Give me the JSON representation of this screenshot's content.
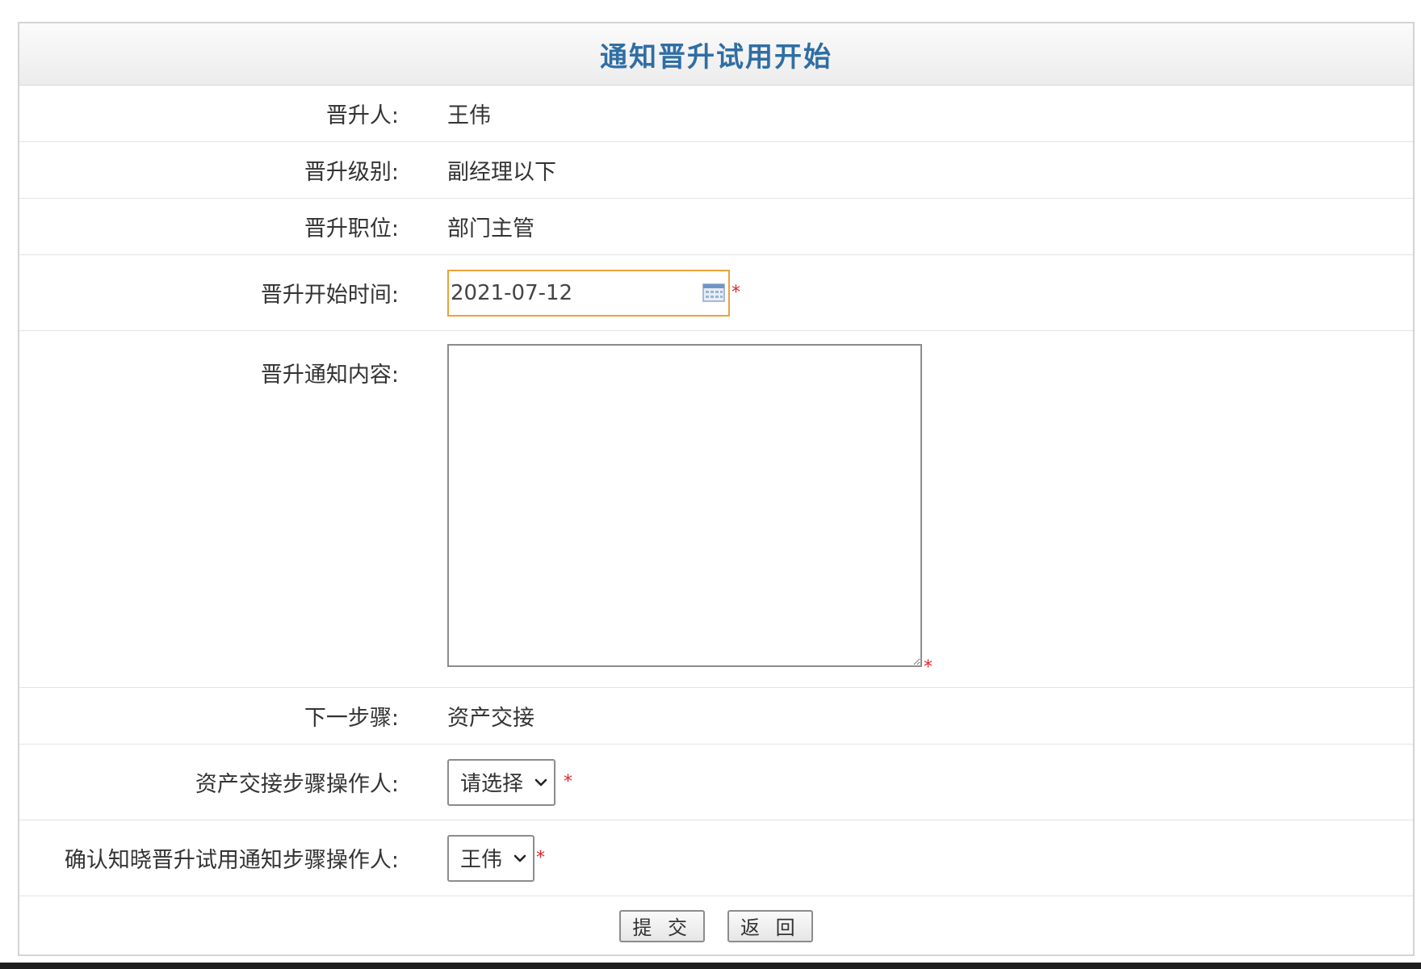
{
  "page": {
    "title": "通知晋升试用开始"
  },
  "form": {
    "promotee": {
      "label": "晋升人:",
      "value": "王伟"
    },
    "level": {
      "label": "晋升级别:",
      "value": "副经理以下"
    },
    "position": {
      "label": "晋升职位:",
      "value": "部门主管"
    },
    "start_date": {
      "label": "晋升开始时间:",
      "value": "2021-07-12",
      "required_mark": "*"
    },
    "notice_content": {
      "label": "晋升通知内容:",
      "value": "",
      "required_mark": "*"
    },
    "next_step": {
      "label": "下一步骤:",
      "value": "资产交接"
    },
    "asset_operator": {
      "label": "资产交接步骤操作人:",
      "selected": "请选择",
      "required_mark": "*"
    },
    "confirm_operator": {
      "label": "确认知晓晋升试用通知步骤操作人:",
      "selected": "王伟",
      "required_mark": "*"
    }
  },
  "actions": {
    "submit_label": "提 交",
    "back_label": "返 回"
  },
  "icons": {
    "date_picker": "calendar-icon",
    "select_arrow": "chevron-down-icon",
    "textarea_resize": "resize-handle-icon"
  },
  "colors": {
    "title": "#2f6ea5",
    "required": "#e0262c",
    "date_focus_border": "#e9a23b"
  }
}
